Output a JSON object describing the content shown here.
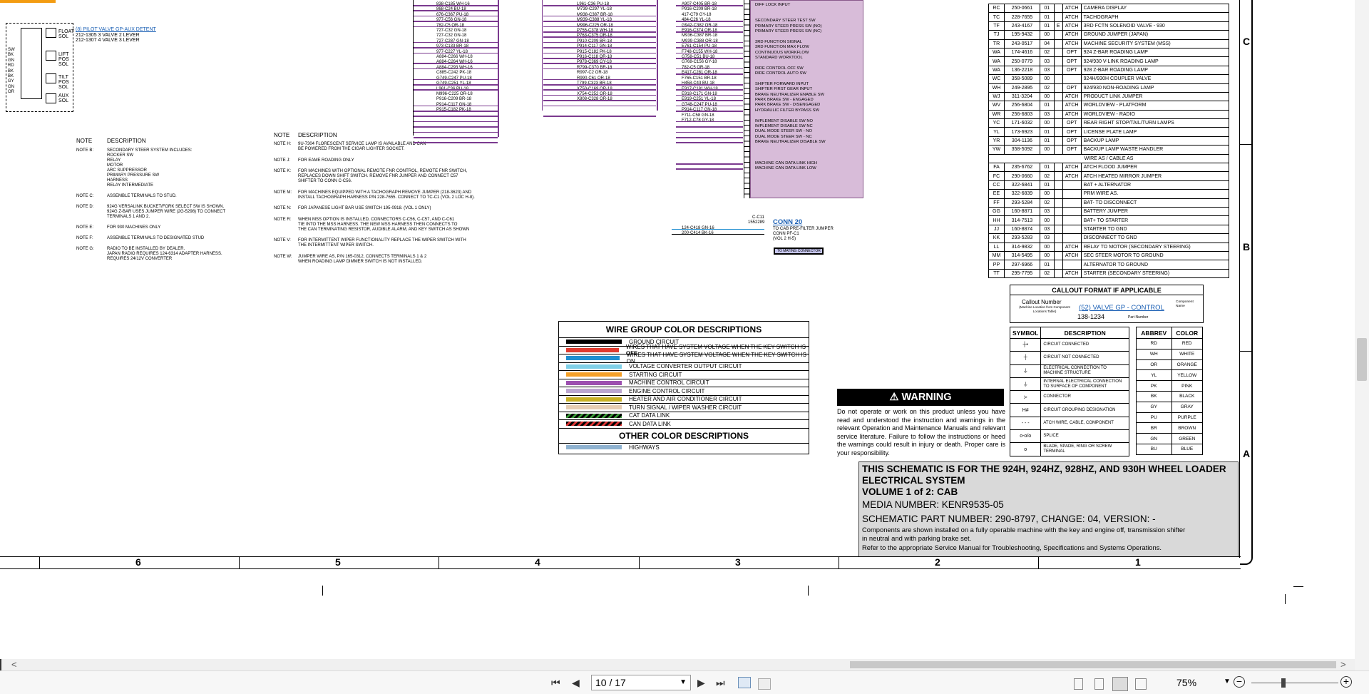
{
  "pins": [
    "SW",
    "BK",
    "GN",
    "RD",
    "BK",
    "BK",
    "GY",
    "GN",
    "OR"
  ],
  "valve": {
    "link": "(8) PILOT VALVE GP-AUX DETENT",
    "line1": "212-1305 3 VALVE 2 LEVER",
    "line2": "212-1307 4 VALVE 3 LEVER",
    "float": "FLOAT SOL",
    "lift": "LIFT POS SOL",
    "tilt": "TILT POS SOL",
    "aux": "AUX SOL"
  },
  "wires_col1": [
    "838-C185 WH-16",
    "868-C24 BU-18",
    "676-C367 PU-18",
    "977-C56 GN-18",
    "782-C5 OR-18",
    "",
    "",
    "727-C32 GN-18",
    "727-C32 GN-18",
    "727-C287 GN-18",
    "",
    "973-C133 BR-18",
    "977-C227 YL-18",
    "",
    "A884-C266 WH-18",
    "A884-C264 WH-16",
    "A884-C293 WH-16",
    "",
    "",
    "C885-C242 PK-18",
    "G749-C247 PU-18",
    "G749-C251 YL-18",
    "L961-C36 PU-18",
    "M996-C225 OR-18",
    "P916-C209 BR-18",
    "P914-C117 GN-18",
    "P915-C182 PK-18"
  ],
  "wires_col2": [
    "L961-C36 PU-18",
    "",
    "M739-C297 YL-18",
    "M938-C387 BR-18",
    "M939-C388 YL-18",
    "M996-C225 OR-18",
    "P755-C378 WH-18",
    "P763-C375 OR-18",
    "P910-C209 BR-18",
    "P914-C117 GN-18",
    "P915-C182 PK-18",
    "P916-C118 OR-18",
    "P978-C369 GY-18",
    "",
    "R799-C370 BR-18",
    "R997-C2 OR-18",
    "R990-C61 OR-18",
    "T799-C323 BR-18",
    "X750-C169 OR-18",
    "X754-C252 OR-18",
    "",
    "X808-C328 OR-18"
  ],
  "wires_col3": [
    "A907-C405 BR-18",
    "",
    "",
    "P916-C209 BR-18",
    "417-C79 GY-18",
    "484-C26 YL-18",
    "",
    "G942-C382 OR-18",
    "E916-C374 OR-18",
    "M936-C387 BR-18",
    "M939-C388 OR-18",
    "",
    "E761-C154 PU-18",
    "F748-C155 WH-18",
    "",
    "G758-C51 BU-18",
    "G768-C156 GY-18",
    "782-C5 OR-18",
    "E417-C281 OR-18",
    "F765-C151 BR-18",
    "H458-C43 BU-18",
    "",
    "E917-C181 WH-18",
    "E918-C171 GN-18",
    "E919-C251 YL-18",
    "G748-C247 PU-18",
    "P914-C117 GN-18",
    "",
    "",
    "",
    "F711-C58 GN-18",
    "F712-C78 GY-18"
  ],
  "wire_bottom": [
    "124-C418 GN-16",
    "200-C414 BK-16"
  ],
  "conn_labels": [
    "DIFF LOCK INPUT",
    "",
    "",
    "SECONDARY STEER TEST SW",
    "PRIMARY STEER PRESS SW (NO)",
    "PRIMARY STEER PRESS SW (NC)",
    "",
    "3RD FUNCTION SIGNAL",
    "3RD FUNCTION MAX FLOW",
    "CONTINUOUS WORKFLOW",
    "STANDARD WORKTOOL",
    "",
    "RIDE CONTROL OFF SW",
    "RIDE CONTROL AUTO SW",
    "",
    "SHIFTER FORWARD INPUT",
    "SHIFTER FIRST GEAR INPUT",
    "BRAKE NEUTRALIZER ENABLE SW",
    "PARK BRAKE SW - ENGAGED",
    "PARK BRAKE SW - DISENGAGED",
    "HYDRAULIC FILTER BYPASS SW",
    "",
    "IMPLEMENT DISABLE SW NO",
    "IMPLEMENT DISABLE SW NC",
    "DUAL MODE STEER SW - NO",
    "DUAL MODE STEER SW - NC",
    "BRAKE NEUTRALIZER DISABLE SW",
    "",
    "",
    "",
    "MACHINE CAN DATA LINK HIGH",
    "MACHINE CAN DATA LINK LOW"
  ],
  "conn20": {
    "id": "C-C11",
    "part": "1552289",
    "title": "CONN 20",
    "l1": "TO CAB PRE-FILTER JUMPER",
    "l2": "CONN PF-C1",
    "l3": "(VOL 2 H-5)",
    "button": "TO MATING CONNECTOR"
  },
  "notes_left": {
    "h_note": "NOTE",
    "h_desc": "DESCRIPTION",
    "rows": [
      {
        "n": "NOTE B:",
        "t": [
          "SECONDARY STEER SYSTEM INCLUDES:",
          "ROCKER SW",
          "RELAY",
          "MOTOR",
          "ARC SUPPRESSOR",
          "PRIMARY PRESSURE SW",
          "HARNESS",
          "RELAY INTERMEDIATE"
        ]
      },
      {
        "n": "NOTE C:",
        "t": [
          "ASSEMBLE TERMINALS TO STUD."
        ]
      },
      {
        "n": "NOTE D:",
        "t": [
          "924G VERSALINK BUCKET/FORK SELECT SW IS SHOWN.",
          "924G Z-BAR USES JUMPER WIRE (2G-5298) TO CONNECT",
          "TERMINALS 1 AND 2."
        ]
      },
      {
        "n": "NOTE E:",
        "t": [
          "FOR 930 MACHINES ONLY"
        ]
      },
      {
        "n": "NOTE F:",
        "t": [
          "ASSEMBLE TERMINALS TO DESIGNATED STUD"
        ]
      },
      {
        "n": "NOTE G:",
        "t": [
          "RADIO TO BE INSTALLED BY DEALER.",
          "JAPAN RADIO REQUIRES 124-6314 ADAPTER HARNESS.",
          "REQUIRES 24/12V CONVERTER"
        ]
      }
    ]
  },
  "notes_mid": {
    "h_note": "NOTE",
    "h_desc": "DESCRIPTION",
    "rows": [
      {
        "n": "NOTE H:",
        "t": [
          "9U-7304 FLORESCENT SERVICE LAMP IS AVAILABLE AND CAN",
          "BE POWERED FROM THE CIGAR LIGHTER SOCKET."
        ]
      },
      {
        "n": "NOTE J:",
        "t": [
          "FOR EAME ROADING ONLY"
        ]
      },
      {
        "n": "NOTE K:",
        "t": [
          "FOR MACHINES WITH OPTIONAL REMOTE FNR CONTROL, REMOTE FNR SWITCH,",
          "REPLACES DOWN SHIFT SWITCH. REMOVE FNR JUMPER AND CONNECT C57",
          "SHIFTER TO CONN C-C56."
        ]
      },
      {
        "n": "NOTE M:",
        "t": [
          "FOR MACHINES EQUIPPED WITH A TACHOGRAPH REMOVE JUMPER (218-3623) AND",
          "INSTALL TACHOGRAPH HARNESS P/N 228-7655. CONNECT TO TC-C1 (VOL 2 LOC H-8)."
        ]
      },
      {
        "n": "NOTE N:",
        "t": [
          "FOR JAPANESE LIGHT BAR USE SWITCH 195-0918. (VOL 1 ONLY)"
        ]
      },
      {
        "n": "NOTE R:",
        "t": [
          "WHEN MSS OPTION IS INSTALLED, CONNECTORS C-C56, C-C57, AND C-C61",
          "TIE INTO THE MSS HARNESS. THE NEW MSS HARNESS THEN CONNECTS TO",
          "THE CAN TERMINATING RESISTOR, AUDIBLE ALARM, AND KEY SWITCH AS SHOWN"
        ]
      },
      {
        "n": "NOTE V:",
        "t": [
          "FOR INTERMITTENT WIPER FUNCTIONALITY REPLACE THE WIPER SWITCH WITH",
          "THE INTERMITTENT WIPER SWITCH."
        ]
      },
      {
        "n": "NOTE W:",
        "t": [
          "JUMPER WIRE AS, P/N 165-0312, CONNECTS TERMINALS 1 & 2",
          "WHEN ROADING LAMP DIMMER SWITCH IS NOT INSTALLED."
        ]
      }
    ]
  },
  "wire_group": {
    "title": "WIRE GROUP COLOR DESCRIPTIONS",
    "rows": [
      {
        "c": "#000000",
        "t": "GROUND CIRCUIT"
      },
      {
        "c": "#e03a2e",
        "t": "WIRES THAT HAVE SYSTEM VOLTAGE WHEN THE KEY SWITCH IS OFF"
      },
      {
        "c": "#1f8ed0",
        "t": "WIRES THAT HAVE SYSTEM VOLTAGE WHEN THE KEY SWITCH IS ON"
      },
      {
        "c": "#7fd0e8",
        "t": "VOLTAGE CONVERTER OUTPUT CIRCUIT"
      },
      {
        "c": "#f5a028",
        "t": "STARTING CIRCUIT"
      },
      {
        "c": "#9c4fb0",
        "t": "MACHINE CONTROL CIRCUIT"
      },
      {
        "c": "#bba6cf",
        "t": "ENGINE CONTROL CIRCUIT"
      },
      {
        "c": "#c8b024",
        "t": "HEATER AND AIR CONDITIONER CIRCUIT"
      },
      {
        "c": "#e6cdb4",
        "t": "TURN SIGNAL / WIPER WASHER CIRCUIT"
      },
      {
        "c": "hatch-green",
        "t": "CAT DATA LINK"
      },
      {
        "c": "hatch-red",
        "t": "CAN DATA LINK"
      }
    ],
    "other_title": "OTHER COLOR DESCRIPTIONS",
    "other": [
      {
        "c": "#8fb2d0",
        "t": "HIGHWAYS"
      }
    ]
  },
  "warning": {
    "title": "WARNING",
    "text": "Do not operate or work on this product unless you have read and understood the instruction and warnings in the relevant Operation and Maintenance Manuals and relevant service literature. Failure to follow the instructions or heed the warnings could result in injury or death. Proper care is your responsibility."
  },
  "components": [
    [
      "RC",
      "250-0661",
      "01",
      "",
      "ATCH",
      "CAMERA DISPLAY"
    ],
    [
      "TC",
      "228-7655",
      "01",
      "",
      "ATCH",
      "TACHOGRAPH"
    ],
    [
      "TF",
      "243-4167",
      "01",
      "E",
      "ATCH",
      "3RD FCTN SOLENOID VALVE - 930"
    ],
    [
      "TJ",
      "195-9432",
      "00",
      "",
      "ATCH",
      "GROUND JUMPER (JAPAN)"
    ],
    [
      "TR",
      "243-0517",
      "04",
      "",
      "ATCH",
      "MACHINE SECURITY SYSTEM (MSS)"
    ],
    [
      "WA",
      "174-4616",
      "02",
      "",
      "OPT",
      "924 Z-BAR ROADING LAMP"
    ],
    [
      "WA",
      "250-0779",
      "03",
      "",
      "OPT",
      "924/930 V-LINK ROADING LAMP"
    ],
    [
      "WA",
      "136-2218",
      "03",
      "",
      "OPT",
      "928 Z-BAR ROADING LAMP"
    ],
    [
      "WC",
      "358-5089",
      "00",
      "",
      "",
      "924H/930H COUPLER VALVE"
    ],
    [
      "WH",
      "249-2895",
      "02",
      "",
      "OPT",
      "924/930 NON-ROADING LAMP"
    ],
    [
      "WJ",
      "311-3204",
      "00",
      "",
      "ATCH",
      "PRODUCT LINK JUMPER"
    ],
    [
      "WV",
      "256-6804",
      "01",
      "",
      "ATCH",
      "WORLDVIEW - PLATFORM"
    ],
    [
      "WR",
      "256-6803",
      "03",
      "",
      "ATCH",
      "WORLDVIEW - RADIO"
    ],
    [
      "YC",
      "171-6032",
      "00",
      "",
      "OPT",
      "REAR RIGHT STOP/TAIL/TURN LAMPS"
    ],
    [
      "YL",
      "173-6923",
      "01",
      "",
      "OPT",
      "LICENSE PLATE LAMP"
    ],
    [
      "YR",
      "304-1136",
      "01",
      "",
      "OPT",
      "BACKUP LAMP"
    ],
    [
      "YW",
      "358-5092",
      "00",
      "",
      "OPT",
      "BACKUP LAMP WASTE HANDLER"
    ],
    [
      "SEC",
      "WIRE AS / CABLE AS"
    ],
    [
      "FA",
      "235-6762",
      "01",
      "",
      "ATCH",
      "ATCH FLOOD JUMPER"
    ],
    [
      "FC",
      "290-0660",
      "02",
      "",
      "ATCH",
      "ATCH HEATED MIRROR JUMPER"
    ],
    [
      "CC",
      "322-6841",
      "01",
      "",
      "",
      "BAT + ALTERNATOR"
    ],
    [
      "EE",
      "322-6839",
      "00",
      "",
      "",
      "PRM WIRE AS."
    ],
    [
      "FF",
      "293-5284",
      "02",
      "",
      "",
      "BAT- TO DISCONNECT"
    ],
    [
      "GG",
      "160-8871",
      "03",
      "",
      "",
      "BATTERY JUMPER"
    ],
    [
      "HH",
      "314-7513",
      "00",
      "",
      "",
      "BAT+ TO STARTER"
    ],
    [
      "JJ",
      "160-8874",
      "03",
      "",
      "",
      "STARTER TO GND"
    ],
    [
      "KK",
      "293-5283",
      "03",
      "",
      "",
      "DISCONNECT TO GND"
    ],
    [
      "LL",
      "314-9832",
      "00",
      "",
      "ATCH",
      "RELAY TO MOTOR (SECONDARY STEERING)"
    ],
    [
      "MM",
      "314-5495",
      "00",
      "",
      "ATCH",
      "SEC STEER MOTOR TO GROUND"
    ],
    [
      "PP",
      "297-6966",
      "01",
      "",
      "",
      "ALTERNATOR TO GROUND"
    ],
    [
      "TT",
      "295-7795",
      "02",
      "",
      "ATCH",
      "STARTER (SECONDARY STEERING)"
    ]
  ],
  "callout": {
    "title": "CALLOUT FORMAT IF APPLICABLE",
    "num": "Callout Number",
    "num_sub": "(Machine Location from Component Locations Table)",
    "link": "(52) VALVE GP - CONTROL",
    "comp": "Component Name",
    "part": "138-1234",
    "part_lbl": "Part Number"
  },
  "symbols": {
    "h1": "SYMBOL",
    "h2": "DESCRIPTION",
    "rows": [
      {
        "s": "┼•",
        "t": "CIRCUIT CONNECTED"
      },
      {
        "s": "┼",
        "t": "CIRCUIT NOT CONNECTED"
      },
      {
        "s": "⏚",
        "t": "ELECTRICAL CONNECTION TO MACHINE STRUCTURE"
      },
      {
        "s": "⏚",
        "t": "INTERNAL ELECTRICAL CONNECTION TO SURFACE OF COMPONENT"
      },
      {
        "s": "≻",
        "t": "CONNECTOR"
      },
      {
        "s": "H#",
        "t": "CIRCUIT GROUPING DESIGNATION"
      },
      {
        "s": "- - -",
        "t": "ATCH WIRE, CABLE, COMPONENT"
      },
      {
        "s": "o-o/o",
        "t": "SPLICE"
      },
      {
        "s": "o",
        "t": "BLADE, SPADE, RING OR SCREW TERMINAL"
      }
    ]
  },
  "abbrev": {
    "h1": "ABBREV",
    "h2": "COLOR",
    "rows": [
      [
        "RD",
        "RED"
      ],
      [
        "WH",
        "WHITE"
      ],
      [
        "OR",
        "ORANGE"
      ],
      [
        "YL",
        "YELLOW"
      ],
      [
        "PK",
        "PINK"
      ],
      [
        "BK",
        "BLACK"
      ],
      [
        "GY",
        "GRAY"
      ],
      [
        "PU",
        "PURPLE"
      ],
      [
        "BR",
        "BROWN"
      ],
      [
        "GN",
        "GREEN"
      ],
      [
        "BU",
        "BLUE"
      ]
    ]
  },
  "titleblock": {
    "l1": "THIS SCHEMATIC IS FOR THE 924H, 924HZ, 928HZ, AND 930H WHEEL LOADER",
    "l2": "ELECTRICAL SYSTEM",
    "l3": "VOLUME 1 of 2: CAB",
    "l4": "MEDIA NUMBER: KENR9535-05",
    "l5": "SCHEMATIC PART NUMBER: 290-8797, CHANGE: 04, VERSION: -",
    "l6": "Components are shown installed on a fully operable machine with the key and engine off, transmission shifter",
    "l7": "in neutral and with parking brake set.",
    "l8": "Refer to the appropriate Service Manual for Troubleshooting, Specifications and Systems Operations."
  },
  "zones": [
    "6",
    "5",
    "4",
    "3",
    "2",
    "1"
  ],
  "side_zones": [
    "C",
    "B",
    "A"
  ],
  "toolbar": {
    "page": "10 / 17",
    "zoom": "75%",
    "nav_first": "⏮",
    "nav_prev": "◀",
    "nav_next": "▶",
    "nav_last": "⏭",
    "scroll_left": "<",
    "scroll_right": ">"
  }
}
